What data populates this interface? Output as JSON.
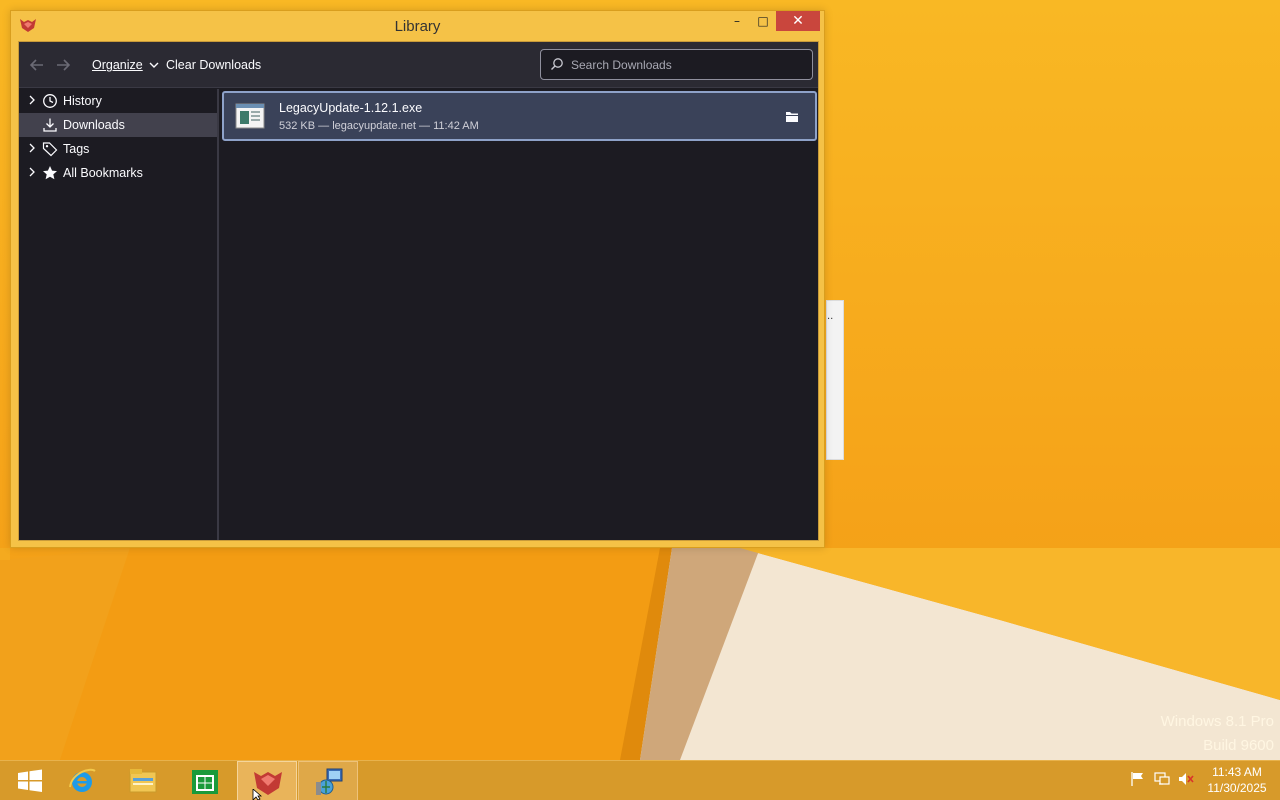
{
  "window": {
    "title": "Library",
    "controls": {
      "minimize": "–",
      "maximize": "□",
      "close": "✕"
    }
  },
  "toolbar": {
    "back_icon": "arrow-left-icon",
    "forward_icon": "arrow-right-icon",
    "organize_label": "Organize",
    "clear_downloads_label": "Clear Downloads",
    "search_placeholder": "Search Downloads",
    "search_value": ""
  },
  "sidebar": {
    "items": [
      {
        "label": "History",
        "icon": "clock-icon",
        "expandable": true,
        "selected": false
      },
      {
        "label": "Downloads",
        "icon": "download-icon",
        "expandable": false,
        "selected": true
      },
      {
        "label": "Tags",
        "icon": "tag-icon",
        "expandable": true,
        "selected": false
      },
      {
        "label": "All Bookmarks",
        "icon": "star-icon",
        "expandable": true,
        "selected": false
      }
    ]
  },
  "downloads": [
    {
      "filename": "LegacyUpdate-1.12.1.exe",
      "details": "532 KB — legacyupdate.net — 11:42 AM",
      "action_icon": "folder-icon"
    }
  ],
  "desktop": {
    "watermark_line1": "Windows 8.1 Pro",
    "watermark_line2": "Build 9600"
  },
  "taskbar": {
    "buttons": [
      "start-icon",
      "internet-explorer-icon",
      "file-explorer-icon",
      "store-icon",
      "firefox-icon",
      "network-app-icon"
    ],
    "tray": [
      "flag-icon",
      "network-icon",
      "volume-muted-icon"
    ],
    "clock_time": "11:43 AM",
    "clock_date": "11/30/2025"
  },
  "colors": {
    "wallpaper": "#f7a919",
    "window_frame": "#f5c247",
    "close_button": "#c9463d",
    "dark_bg": "#1c1b22",
    "selected_item": "#3a4259"
  }
}
